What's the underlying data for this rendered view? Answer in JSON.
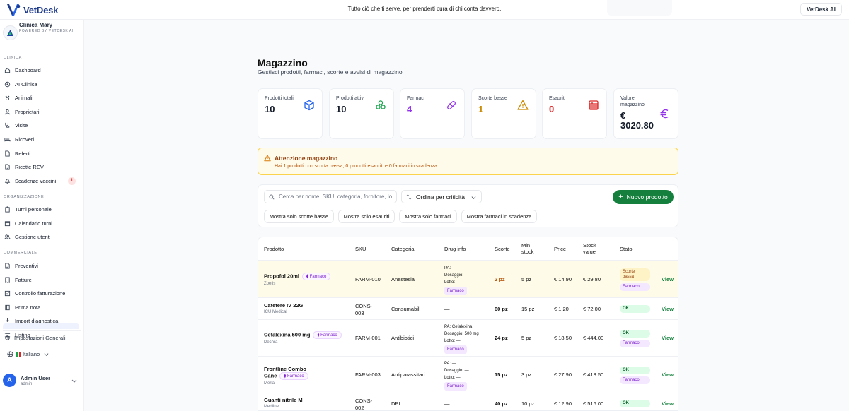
{
  "app": {
    "name": "VetDesk",
    "tagline": "Tutto ciò che ti serve, per prenderti cura di chi conta davvero.",
    "top_button": "VetDesk AI"
  },
  "clinic": {
    "name": "Clinica Mary",
    "powered": "POWERED BY VETDESK AI"
  },
  "sidebar": {
    "sections": {
      "clinica": "CLINICA",
      "organizzazione": "ORGANIZZAZIONE",
      "commerciale": "COMMERCIALE"
    },
    "clinica_items": [
      {
        "label": "Dashboard",
        "icon": "home-icon"
      },
      {
        "label": "AI Clinica",
        "icon": "ai-icon"
      },
      {
        "label": "Animali",
        "icon": "paw-icon"
      },
      {
        "label": "Proprietari",
        "icon": "user-icon"
      },
      {
        "label": "Visite",
        "icon": "stethoscope-icon"
      },
      {
        "label": "Ricoveri",
        "icon": "bed-icon"
      },
      {
        "label": "Referti",
        "icon": "file-icon"
      },
      {
        "label": "Ricette REV",
        "icon": "prescription-icon"
      },
      {
        "label": "Scadenze vaccini",
        "icon": "bell-icon",
        "badge": "1"
      }
    ],
    "org_items": [
      {
        "label": "Turni personale",
        "icon": "clipboard-icon"
      },
      {
        "label": "Calendario turni",
        "icon": "calendar-icon"
      },
      {
        "label": "Gestione utenti",
        "icon": "users-icon"
      }
    ],
    "comm_items": [
      {
        "label": "Preventivi",
        "icon": "document-icon"
      },
      {
        "label": "Fatture",
        "icon": "invoice-icon"
      },
      {
        "label": "Controllo fatturazione",
        "icon": "check-icon"
      },
      {
        "label": "Prima nota",
        "icon": "book-icon"
      },
      {
        "label": "Import diagnostica",
        "icon": "import-icon"
      },
      {
        "label": "Listino",
        "icon": "list-icon"
      }
    ],
    "settings": "Impostazioni Generali",
    "language": "Italiano",
    "user": {
      "initial": "A",
      "name": "Admin User",
      "role": "admin"
    }
  },
  "page": {
    "title": "Magazzino",
    "subtitle": "Gestisci prodotti, farmaci, scorte e avvisi di magazzino"
  },
  "stats": [
    {
      "label": "Prodotti totali",
      "value": "10",
      "color": "#111827",
      "icon": "box-icon"
    },
    {
      "label": "Prodotti attivi",
      "value": "10",
      "color": "#111827",
      "icon": "cluster-icon"
    },
    {
      "label": "Farmaci",
      "value": "4",
      "color": "#9333ea",
      "icon": "pill-icon"
    },
    {
      "label": "Scorte basse",
      "value": "1",
      "color": "#ca8a04",
      "icon": "warning-icon"
    },
    {
      "label": "Esauriti",
      "value": "0",
      "color": "#dc2626",
      "icon": "archive-icon"
    },
    {
      "label": "Valore magazzino",
      "value": "€ 3020.80",
      "color": "#111827",
      "icon": "euro-icon"
    }
  ],
  "alert": {
    "title": "Attenzione magazzino",
    "text": "Hai 1 prodotti con scorta bassa, 0 prodotti esauriti e 0 farmaci in scadenza."
  },
  "filters": {
    "search_placeholder": "Cerca per nome, SKU, categoria, fornitore, lotto...",
    "sort_label": "Ordina per criticità",
    "new_button": "Nuovo prodotto",
    "buttons": [
      "Mostra solo scorte basse",
      "Mostra solo esauriti",
      "Mostra solo farmaci",
      "Mostra farmaci in scadenza"
    ]
  },
  "table": {
    "headers": [
      "Prodotto",
      "SKU",
      "Categoria",
      "Drug info",
      "Scorte",
      "Min stock",
      "Price",
      "Stock value",
      "Stato"
    ],
    "rows": [
      {
        "name": "Propofol 20ml",
        "brand": "Zoetis",
        "farmaco": "Farmaco",
        "sku": "FARM-010",
        "category": "Anestesia",
        "drug": [
          "PA: —",
          "Dosaggio: —",
          "Lotto: —"
        ],
        "drug_tag": "Farmaco",
        "stock": "2 pz",
        "min": "5 pz",
        "price": "€ 14.90",
        "value": "€ 29.80",
        "status": "Scorte bassa",
        "status2": "Farmaco",
        "action": "View"
      },
      {
        "name": "Catetere IV 22G",
        "brand": "ICU Medical",
        "farmaco": "",
        "sku": "CONS-003",
        "category": "Consumabili",
        "drug_dash": "—",
        "stock": "60 pz",
        "min": "15 pz",
        "price": "€ 1.20",
        "value": "€ 72.00",
        "status": "OK",
        "status2": "",
        "action": "View"
      },
      {
        "name": "Cefalexina 500 mg",
        "brand": "Dechra",
        "farmaco": "Farmaco",
        "sku": "FARM-001",
        "category": "Antibiotici",
        "drug": [
          "PA: Cefalexina",
          "Dosaggio: 500 mg",
          "Lotto: —"
        ],
        "drug_tag": "Farmaco",
        "stock": "24 pz",
        "min": "5 pz",
        "price": "€ 18.50",
        "value": "€ 444.00",
        "status": "OK",
        "status2": "Farmaco",
        "action": "View"
      },
      {
        "name": "Frontline Combo Cane",
        "brand": "Merial",
        "farmaco": "Farmaco",
        "sku": "FARM-003",
        "category": "Antiparassitari",
        "drug": [
          "PA: —",
          "Dosaggio: —",
          "Lotto: —"
        ],
        "drug_tag": "Farmaco",
        "stock": "15 pz",
        "min": "3 pz",
        "price": "€ 27.90",
        "value": "€ 418.50",
        "status": "OK",
        "status2": "Farmaco",
        "action": "View"
      },
      {
        "name": "Guanti nitrile M",
        "brand": "Medline",
        "farmaco": "",
        "sku": "CONS-002",
        "category": "DPI",
        "drug_dash": "—",
        "stock": "40 pz",
        "min": "10 pz",
        "price": "€ 12.90",
        "value": "€ 516.00",
        "status": "OK",
        "status2": "",
        "action": "View"
      }
    ]
  }
}
